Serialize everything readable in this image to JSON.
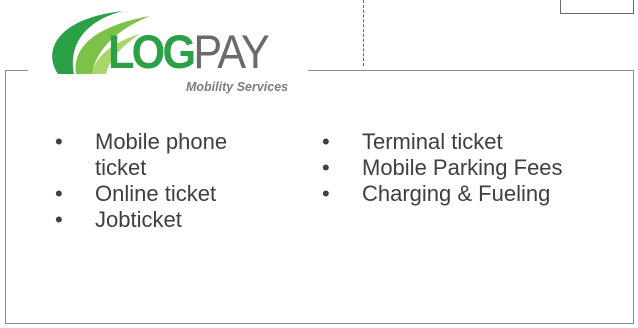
{
  "logo": {
    "brand_strong": "LOG",
    "brand_light": "PAY",
    "tagline": "Mobility Services",
    "colors": {
      "green": "#2ba046",
      "light_green": "#7cc24a",
      "gray": "#6a6a6a"
    }
  },
  "services": {
    "left": [
      "Mobile phone ticket",
      "Online ticket",
      "Jobticket"
    ],
    "right": [
      "Terminal ticket",
      "Mobile Parking Fees",
      "Charging & Fueling"
    ]
  }
}
